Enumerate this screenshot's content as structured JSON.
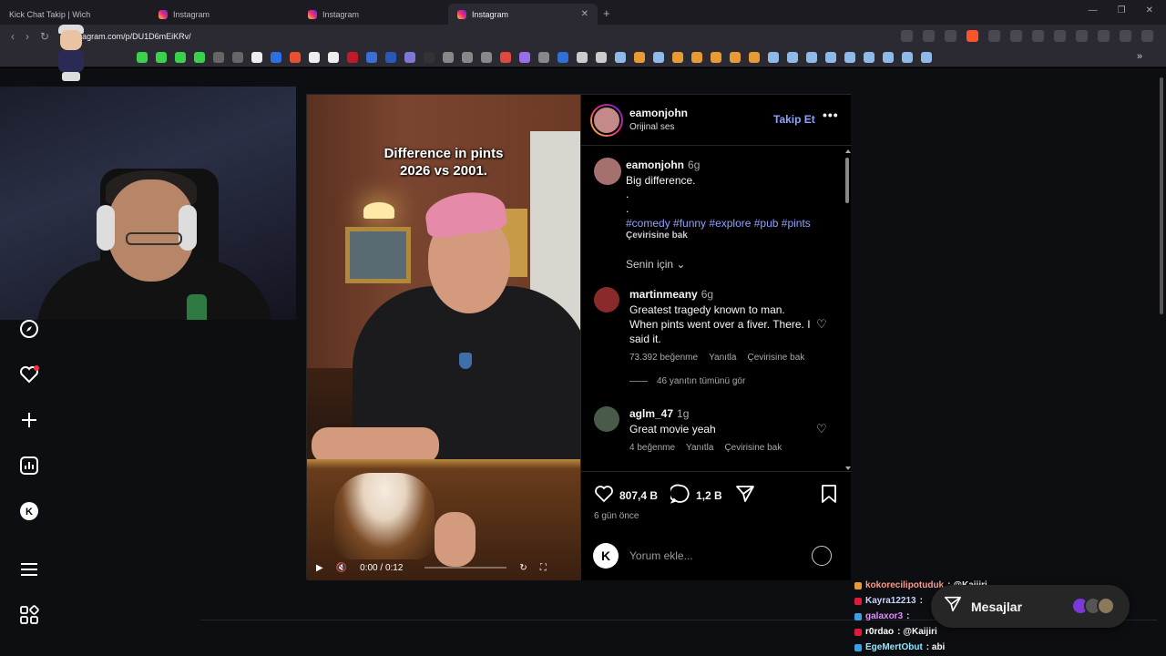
{
  "browser": {
    "tabs": [
      {
        "label": "Kick Chat Takip | Wich",
        "active": false
      },
      {
        "label": "Instagram",
        "active": false
      },
      {
        "label": "Instagram",
        "active": false
      },
      {
        "label": "Instagram",
        "active": true
      }
    ],
    "url": "instagram.com/p/DU1D6mEiKRv/"
  },
  "video": {
    "caption_line1": "Difference in pints",
    "caption_line2": "2026 vs 2001.",
    "time": "0:00 / 0:12"
  },
  "post": {
    "username": "eamonjohn",
    "audio": "Orijinal ses",
    "follow_label": "Takip Et",
    "more": "•••",
    "caption": {
      "username": "eamonjohn",
      "time": "6g",
      "text": "Big difference.",
      "dot1": ".",
      "dot2": ".",
      "hashtags": "#comedy #funny #explore #pub #pints",
      "translate": "Çevirisine bak"
    },
    "sort_label": "Senin için",
    "comments": [
      {
        "username": "martinmeany",
        "time": "6g",
        "text": "Greatest tragedy known to man. When pints went over a fiver. There. I said it.",
        "likes": "73.392 beğenme",
        "reply": "Yanıtla",
        "translate": "Çevirisine bak",
        "replies_label": "46 yanıtın tümünü gör"
      },
      {
        "username": "aglm_47",
        "time": "1g",
        "text": "Great movie yeah",
        "likes": "4 beğenme",
        "reply": "Yanıtla",
        "translate": "Çevirisine bak"
      }
    ],
    "likes_count": "807,4 B",
    "comments_count": "1,2 B",
    "date": "6 gün önce",
    "add_comment_placeholder": "Yorum ekle..."
  },
  "chat": [
    {
      "user": "kokorecilipotuduk",
      "msg": ": @Kaijiri",
      "color": "#ff9a8a"
    },
    {
      "user": "Kayra12213",
      "msg": ":",
      "color": "#c9d3ff"
    },
    {
      "user": "galaxor3",
      "msg": ":",
      "color": "#e38cff"
    },
    {
      "user": "r0rdao",
      "msg": ": @Kaijiri",
      "color": "#ffffff"
    },
    {
      "user": "EgeMertObut",
      "msg": ": abi",
      "color": "#8ee8ff"
    }
  ],
  "messages": {
    "label": "Mesajlar"
  },
  "colors": {
    "accent_link": "#8ea2ff",
    "notif": "#ff3040"
  }
}
